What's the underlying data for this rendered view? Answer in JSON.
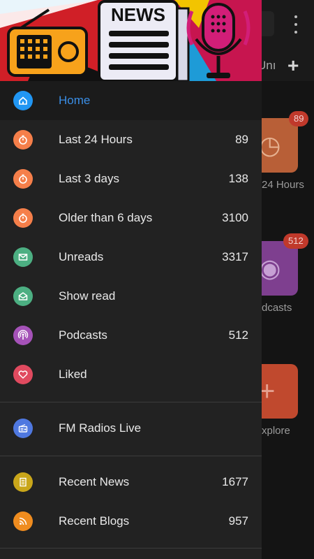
{
  "background": {
    "tab_label": "Unı",
    "tiles": [
      {
        "badge": "89",
        "caption": "24 Hours"
      },
      {
        "badge": "512",
        "caption": "dcasts"
      },
      {
        "caption": "xplore"
      }
    ]
  },
  "drawer": {
    "banner": {
      "news_text": "NEWS"
    },
    "items": [
      {
        "label": "Home",
        "count": "",
        "icon": "home-icon",
        "color": "#2196f3"
      },
      {
        "label": "Last 24 Hours",
        "count": "89",
        "icon": "stopwatch-icon",
        "color": "#f57f4a"
      },
      {
        "label": "Last 3 days",
        "count": "138",
        "icon": "stopwatch-icon",
        "color": "#f57f4a"
      },
      {
        "label": "Older than 6 days",
        "count": "3100",
        "icon": "stopwatch-icon",
        "color": "#f57f4a"
      },
      {
        "label": "Unreads",
        "count": "3317",
        "icon": "mail-icon",
        "color": "#4caf82"
      },
      {
        "label": "Show read",
        "count": "",
        "icon": "mail-open-icon",
        "color": "#4caf82"
      },
      {
        "label": "Podcasts",
        "count": "512",
        "icon": "podcast-icon",
        "color": "#a552b8"
      },
      {
        "label": "Liked",
        "count": "",
        "icon": "heart-icon",
        "color": "#e04a5f"
      },
      {
        "label": "FM Radios Live",
        "count": "",
        "icon": "radio-icon",
        "color": "#4f78e0"
      },
      {
        "label": "Recent News",
        "count": "1677",
        "icon": "news-icon",
        "color": "#c9a61a"
      },
      {
        "label": "Recent Blogs",
        "count": "957",
        "icon": "rss-icon",
        "color": "#ef8c1f"
      }
    ]
  }
}
